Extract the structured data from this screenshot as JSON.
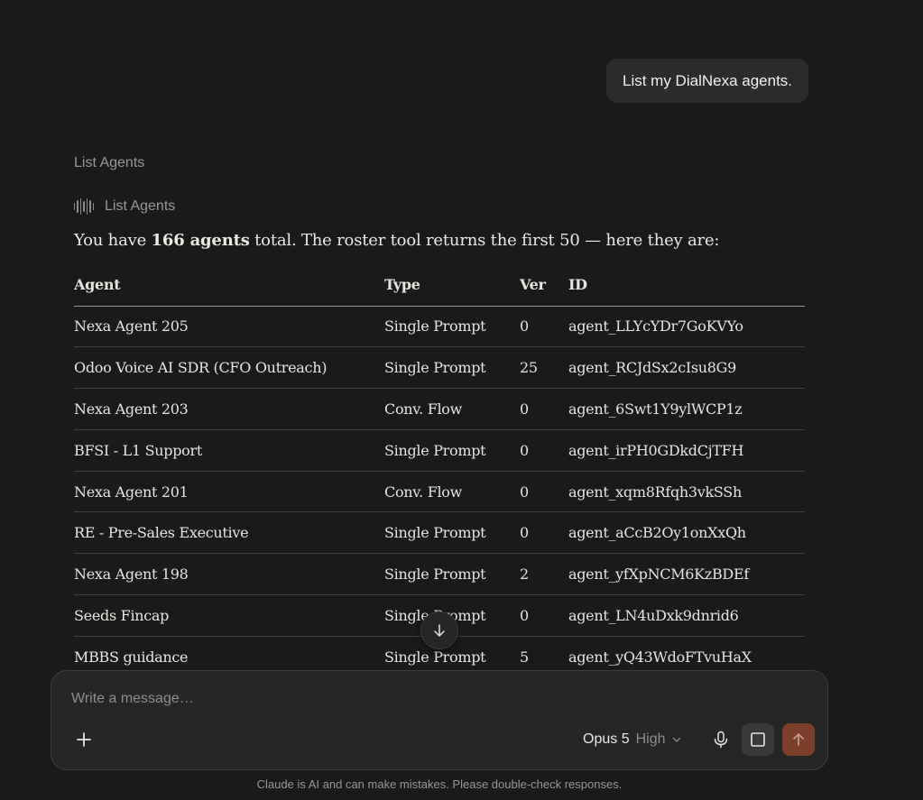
{
  "user_message": "List my DialNexa agents.",
  "tool": {
    "label": "List Agents",
    "call_label": "List Agents",
    "icon": "waveform-icon"
  },
  "response": {
    "intro_before": "You have ",
    "intro_bold": "166 agents",
    "intro_after": " total. The roster tool returns the first 50 — here they are:"
  },
  "table": {
    "headers": [
      "Agent",
      "Type",
      "Ver",
      "ID"
    ],
    "rows": [
      [
        "Nexa Agent 205",
        "Single Prompt",
        "0",
        "agent_LLYcYDr7GoKVYo"
      ],
      [
        "Odoo Voice AI SDR (CFO Outreach)",
        "Single Prompt",
        "25",
        "agent_RCJdSx2cIsu8G9"
      ],
      [
        "Nexa Agent 203",
        "Conv. Flow",
        "0",
        "agent_6Swt1Y9ylWCP1z"
      ],
      [
        "BFSI - L1 Support",
        "Single Prompt",
        "0",
        "agent_irPH0GDkdCjTFH"
      ],
      [
        "Nexa Agent 201",
        "Conv. Flow",
        "0",
        "agent_xqm8Rfqh3vkSSh"
      ],
      [
        "RE - Pre-Sales Executive",
        "Single Prompt",
        "0",
        "agent_aCcB2Oy1onXxQh"
      ],
      [
        "Nexa Agent 198",
        "Single Prompt",
        "2",
        "agent_yfXpNCM6KzBDEf"
      ],
      [
        "Seeds Fincap",
        "Single Prompt",
        "0",
        "agent_LN4uDxk9dnrid6"
      ],
      [
        "MBBS guidance",
        "Single Prompt",
        "5",
        "agent_yQ43WdoFTvuHaX"
      ]
    ]
  },
  "composer": {
    "placeholder": "Write a message…",
    "model": "Opus 5",
    "effort": "High"
  },
  "disclaimer": "Claude is AI and can make mistakes. Please double-check responses.",
  "colors": {
    "background": "#1a1a1a",
    "send_button": "#7b3f2c"
  }
}
